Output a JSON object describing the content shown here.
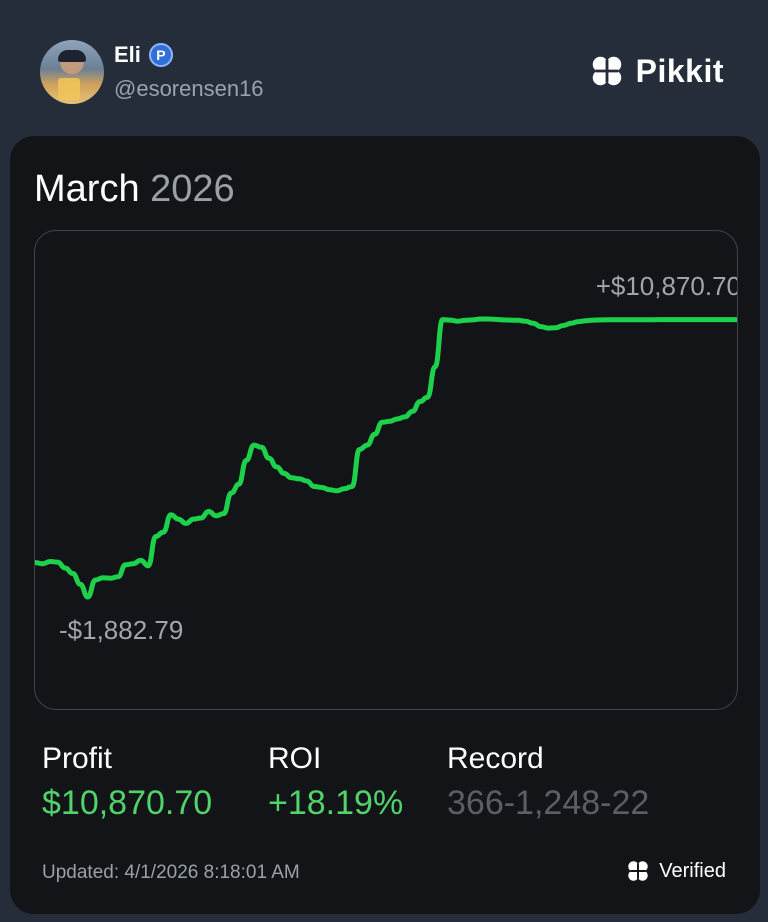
{
  "profile": {
    "name": "Eli",
    "badge_letter": "P",
    "handle": "@esorensen16"
  },
  "brand": {
    "name": "Pikkit"
  },
  "card": {
    "month": "March",
    "year": "2026"
  },
  "chart_data": {
    "type": "line",
    "x": [
      0,
      0.33,
      0.67,
      1,
      1.33,
      1.67,
      2,
      2.33,
      2.67,
      3,
      3.33,
      3.67,
      4,
      4.33,
      4.67,
      5,
      5.33,
      5.67,
      6,
      6.33,
      6.67,
      7,
      7.33,
      7.67,
      8,
      8.33,
      8.67,
      9,
      9.33,
      9.67,
      10,
      10.33,
      10.67,
      11,
      11.33,
      11.67,
      12,
      12.33,
      12.67,
      13,
      13.33,
      13.67,
      14,
      14.33,
      14.67,
      15,
      15.33,
      15.67,
      16,
      16.33,
      16.67,
      17,
      17.33,
      17.67,
      18,
      18.33,
      18.67,
      19,
      19.33,
      19.67,
      20,
      20.33,
      20.67,
      21,
      21.33,
      21.67,
      22,
      22.33,
      22.67,
      23,
      23.33,
      23.67,
      24,
      24.33,
      24.67,
      25,
      25.33,
      25.67,
      26,
      26.33,
      26.67,
      27,
      27.33,
      27.67,
      28,
      28.33,
      28.67,
      29,
      29.33,
      29.67,
      30,
      30.33,
      30.67,
      31
    ],
    "values": [
      -300,
      -350,
      -250,
      -280,
      -550,
      -800,
      -1300,
      -1882.79,
      -1100,
      -1000,
      -1020,
      -950,
      -400,
      -350,
      -200,
      -450,
      900,
      1100,
      1900,
      1700,
      1500,
      1700,
      1750,
      2050,
      1850,
      1950,
      2900,
      3300,
      4400,
      5100,
      5000,
      4500,
      4100,
      3800,
      3600,
      3550,
      3450,
      3200,
      3150,
      3050,
      3000,
      3100,
      3200,
      4900,
      5100,
      5600,
      6150,
      6200,
      6300,
      6400,
      6650,
      7100,
      7300,
      8700,
      10870.7,
      10850,
      10800,
      10840,
      10860,
      10900,
      10900,
      10880,
      10860,
      10850,
      10840,
      10800,
      10700,
      10550,
      10480,
      10500,
      10600,
      10700,
      10780,
      10820,
      10850,
      10860,
      10865,
      10866,
      10867,
      10868,
      10869,
      10869.5,
      10870,
      10870.3,
      10870.5,
      10870.6,
      10870.65,
      10870.68,
      10870.69,
      10870.7,
      10870.7,
      10870.7,
      10870.7,
      10870.7
    ],
    "min_label": "-$1,882.79",
    "max_label": "+$10,870.70",
    "line_color": "#1ed14b",
    "grid": false
  },
  "stats": {
    "profit": {
      "label": "Profit",
      "value": "$10,870.70"
    },
    "roi": {
      "label": "ROI",
      "value": "+18.19%"
    },
    "record": {
      "label": "Record",
      "value": "366-1,248-22"
    }
  },
  "footer": {
    "updated": "Updated: 4/1/2026 8:18:01 AM",
    "verified": "Verified"
  },
  "colors": {
    "background": "#262d3a",
    "card": "#121418",
    "positive": "#4fd36a",
    "muted": "#5a5f67"
  }
}
